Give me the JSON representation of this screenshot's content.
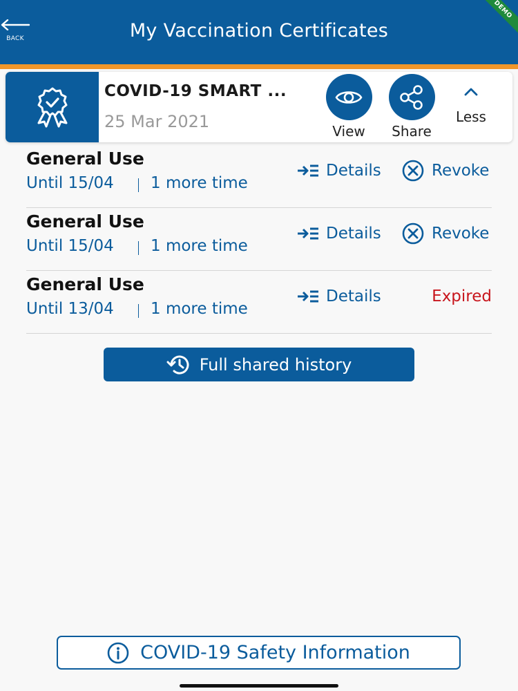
{
  "header": {
    "back_label": "BACK",
    "title": "My Vaccination Certificates",
    "ribbon": "DEMO"
  },
  "certificate": {
    "title": "COVID-19 SMART ...",
    "date": "25 Mar 2021",
    "actions": {
      "view": "View",
      "share": "Share",
      "less": "Less"
    }
  },
  "shares": [
    {
      "title": "General Use",
      "until": "Until 15/04",
      "uses": "1 more time",
      "details": "Details",
      "status": "Revoke",
      "status_type": "revoke"
    },
    {
      "title": "General Use",
      "until": "Until 15/04",
      "uses": "1 more time",
      "details": "Details",
      "status": "Revoke",
      "status_type": "revoke"
    },
    {
      "title": "General Use",
      "until": "Until 13/04",
      "uses": "1 more time",
      "details": "Details",
      "status": "Expired",
      "status_type": "expired"
    }
  ],
  "history_button": "Full shared history",
  "safety_button": "COVID-19 Safety Information",
  "colors": {
    "primary": "#0b5c9c",
    "accent_stripe": "#f0962a",
    "expired": "#c8161d",
    "demo_ribbon": "#1f8a3b"
  },
  "icons": {
    "back": "arrow-left-icon",
    "badge": "award-rosette-icon",
    "view": "eye-icon",
    "share": "share-nodes-icon",
    "less": "chevron-up-icon",
    "details": "details-list-icon",
    "revoke": "circle-x-icon",
    "history": "history-clock-icon",
    "info": "info-circle-icon"
  }
}
